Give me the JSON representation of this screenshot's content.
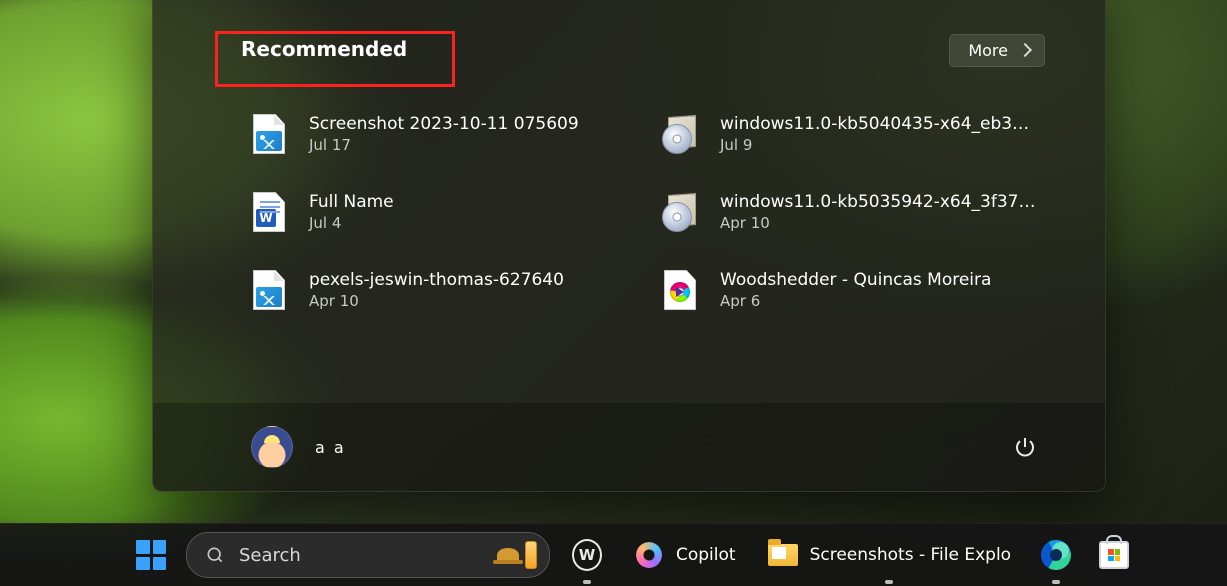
{
  "start_menu": {
    "recommended_title": "Recommended",
    "more_label": "More",
    "items": [
      {
        "name": "Screenshot 2023-10-11 075609",
        "date": "Jul 17",
        "icon": "image-file-icon"
      },
      {
        "name": "windows11.0-kb5040435-x64_eb3b…",
        "date": "Jul 9",
        "icon": "package-icon"
      },
      {
        "name": "Full Name",
        "date": "Jul 4",
        "icon": "word-doc-icon"
      },
      {
        "name": "windows11.0-kb5035942-x64_3f371…",
        "date": "Apr 10",
        "icon": "package-icon"
      },
      {
        "name": "pexels-jeswin-thomas-627640",
        "date": "Apr 10",
        "icon": "image-file-icon"
      },
      {
        "name": "Woodshedder - Quincas Moreira",
        "date": "Apr 6",
        "icon": "media-file-icon"
      }
    ],
    "user": {
      "name": "a a"
    }
  },
  "taskbar": {
    "search_label": "Search",
    "copilot_label": "Copilot",
    "explorer_label": "Screenshots - File Explo"
  }
}
